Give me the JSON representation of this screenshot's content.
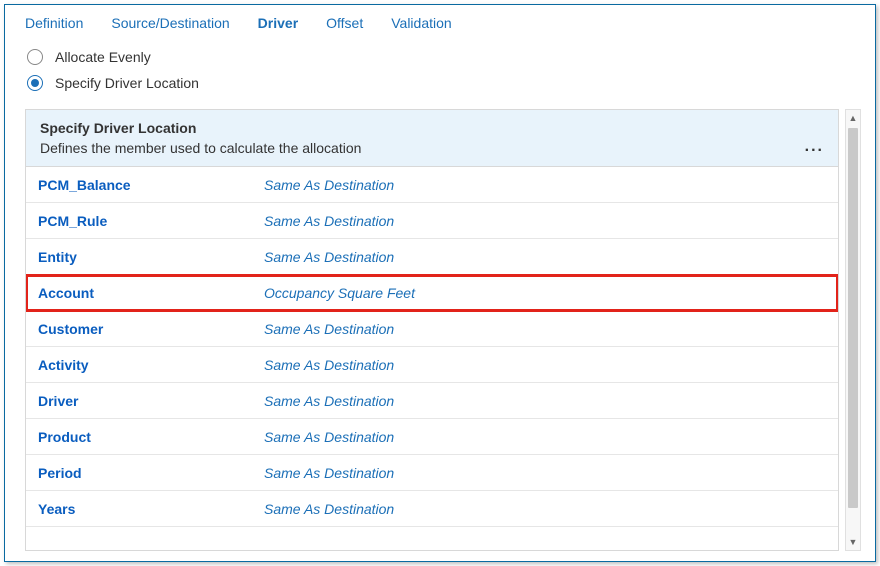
{
  "tabs": [
    {
      "label": "Definition",
      "active": false
    },
    {
      "label": "Source/Destination",
      "active": false
    },
    {
      "label": "Driver",
      "active": true
    },
    {
      "label": "Offset",
      "active": false
    },
    {
      "label": "Validation",
      "active": false
    }
  ],
  "radios": {
    "allocate_evenly": "Allocate Evenly",
    "specify_driver_location": "Specify Driver Location",
    "selected": "specify_driver_location"
  },
  "panel": {
    "title": "Specify Driver Location",
    "description": "Defines the member used to calculate the allocation",
    "more_label": "...",
    "rows": [
      {
        "dimension": "PCM_Balance",
        "value": "Same As Destination",
        "highlighted": false
      },
      {
        "dimension": "PCM_Rule",
        "value": "Same As Destination",
        "highlighted": false
      },
      {
        "dimension": "Entity",
        "value": "Same As Destination",
        "highlighted": false
      },
      {
        "dimension": "Account",
        "value": "Occupancy Square Feet",
        "highlighted": true
      },
      {
        "dimension": "Customer",
        "value": "Same As Destination",
        "highlighted": false
      },
      {
        "dimension": "Activity",
        "value": "Same As Destination",
        "highlighted": false
      },
      {
        "dimension": "Driver",
        "value": "Same As Destination",
        "highlighted": false
      },
      {
        "dimension": "Product",
        "value": "Same As Destination",
        "highlighted": false
      },
      {
        "dimension": "Period",
        "value": "Same As Destination",
        "highlighted": false
      },
      {
        "dimension": "Years",
        "value": "Same As Destination",
        "highlighted": false
      }
    ]
  }
}
